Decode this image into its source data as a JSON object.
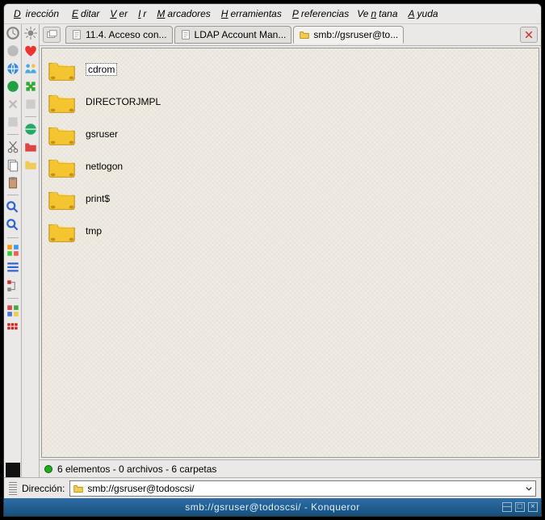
{
  "menu": {
    "direccion": "Dirección",
    "editar": "Editar",
    "ver": "Ver",
    "ir": "Ir",
    "marcadores": "Marcadores",
    "herramientas": "Herramientas",
    "preferencias": "Preferencias",
    "ventana": "Ventana",
    "ayuda": "Ayuda"
  },
  "tabs": [
    {
      "label": "11.4. Acceso con...",
      "icon": "doc"
    },
    {
      "label": "LDAP Account Man...",
      "icon": "doc"
    },
    {
      "label": "smb://gsruser@to...",
      "icon": "folder",
      "active": true
    }
  ],
  "items": [
    {
      "name": "cdrom",
      "selected": true
    },
    {
      "name": "DIRECTORJMPL"
    },
    {
      "name": "gsruser"
    },
    {
      "name": "netlogon"
    },
    {
      "name": "print$"
    },
    {
      "name": "tmp"
    }
  ],
  "status": "6 elementos - 0 archivos - 6 carpetas",
  "address": {
    "label": "Dirección:",
    "value": "smb://gsruser@todoscsi/"
  },
  "title": "smb://gsruser@todoscsi/ - Konqueror"
}
